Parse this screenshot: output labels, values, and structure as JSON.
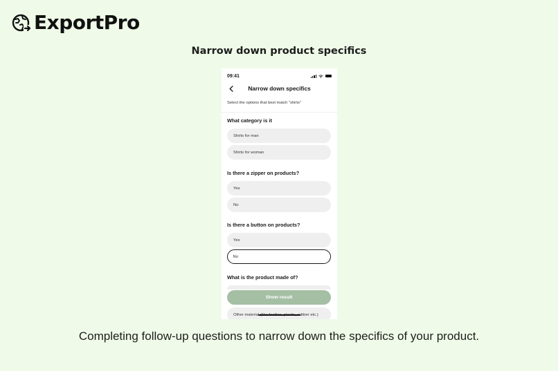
{
  "brand": {
    "name": "ExportPro",
    "logo_icon": "globe-arrow-icon"
  },
  "headline": "Narrow down product specifics",
  "caption": "Completing follow-up questions to narrow down the specifics of your product.",
  "phone": {
    "status_time": "09:41",
    "nav_title": "Narrow down specifics",
    "subtitle": "Select the options that best match \"shirts\"",
    "questions": [
      {
        "title": "What category is it",
        "options": [
          "Shirts for man",
          "Shirts for woman"
        ]
      },
      {
        "title": "Is there a zipper on products?",
        "options": [
          "Yes",
          "No"
        ]
      },
      {
        "title": "Is there a button on products?",
        "options": [
          "Yes",
          "No"
        ],
        "selected": "No"
      },
      {
        "title": "What is the product made of?",
        "options": [
          "Other material (like feather, plastic, rubber etc.)"
        ]
      }
    ],
    "cta_label": "Show result",
    "colors": {
      "cta_bg": "#a5bfa4",
      "page_bg": "#effbe8",
      "option_bg": "#efefef"
    }
  }
}
